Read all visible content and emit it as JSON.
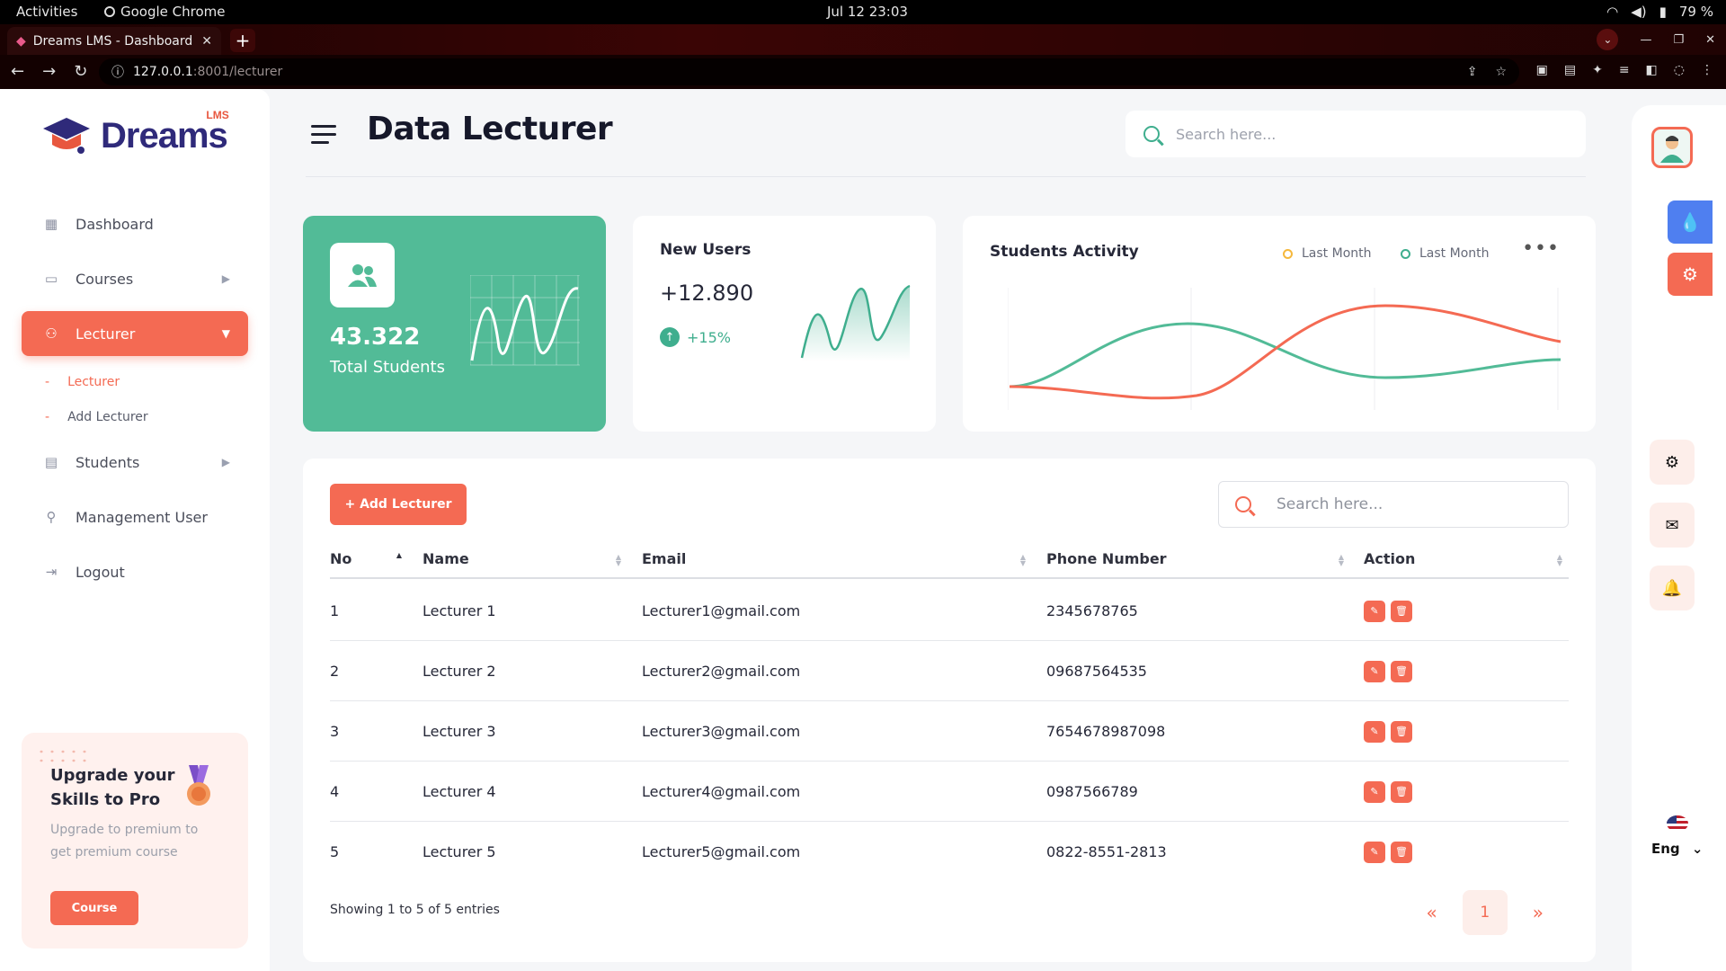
{
  "os": {
    "activities": "Activities",
    "app": "Google Chrome",
    "clock": "Jul 12  23:03",
    "battery": "79 %"
  },
  "browser": {
    "tab_title": "Dreams LMS - Dashboard",
    "url_host": "127.0.0.1",
    "url_rest": ":8001/lecturer"
  },
  "sidebar": {
    "logo_text": "Dreams",
    "logo_badge": "LMS",
    "items": [
      {
        "label": "Dashboard"
      },
      {
        "label": "Courses"
      },
      {
        "label": "Lecturer"
      },
      {
        "label": "Students"
      },
      {
        "label": "Management User"
      },
      {
        "label": "Logout"
      }
    ],
    "sub_items": [
      {
        "label": "Lecturer"
      },
      {
        "label": "Add Lecturer"
      }
    ],
    "upgrade": {
      "title": "Upgrade your Skills to Pro",
      "desc": "Upgrade to premium to get premium course",
      "button": "Course"
    }
  },
  "header": {
    "title": "Data Lecturer",
    "search_placeholder": "Search here..."
  },
  "cards": {
    "students": {
      "value": "43.322",
      "label": "Total Students"
    },
    "new_users": {
      "title": "New Users",
      "value": "+12.890",
      "change": "+15%"
    },
    "activity": {
      "title": "Students Activity",
      "legend": [
        "Last Month",
        "Last Month"
      ],
      "legend_colors": [
        "#f5b83d",
        "#3fae8e"
      ]
    }
  },
  "table": {
    "add_button": "+ Add Lecturer",
    "search_placeholder": "Search here...",
    "columns": [
      "No",
      "Name",
      "Email",
      "Phone Number",
      "Action"
    ],
    "rows": [
      {
        "no": "1",
        "name": "Lecturer 1",
        "email": "Lecturer1@gmail.com",
        "phone": "2345678765"
      },
      {
        "no": "2",
        "name": "Lecturer 2",
        "email": "Lecturer2@gmail.com",
        "phone": "09687564535"
      },
      {
        "no": "3",
        "name": "Lecturer 3",
        "email": "Lecturer3@gmail.com",
        "phone": "7654678987098"
      },
      {
        "no": "4",
        "name": "Lecturer 4",
        "email": "Lecturer4@gmail.com",
        "phone": "0987566789"
      },
      {
        "no": "5",
        "name": "Lecturer 5",
        "email": "Lecturer5@gmail.com",
        "phone": "0822-8551-2813"
      }
    ],
    "showing": "Showing 1 to 5 of 5 entries",
    "pagination": {
      "prev": "«",
      "page": "1",
      "next": "»"
    }
  },
  "rail": {
    "language": "Eng"
  },
  "colors": {
    "accent": "#f46a53",
    "green": "#52bb97",
    "blue": "#4f7ff0"
  }
}
